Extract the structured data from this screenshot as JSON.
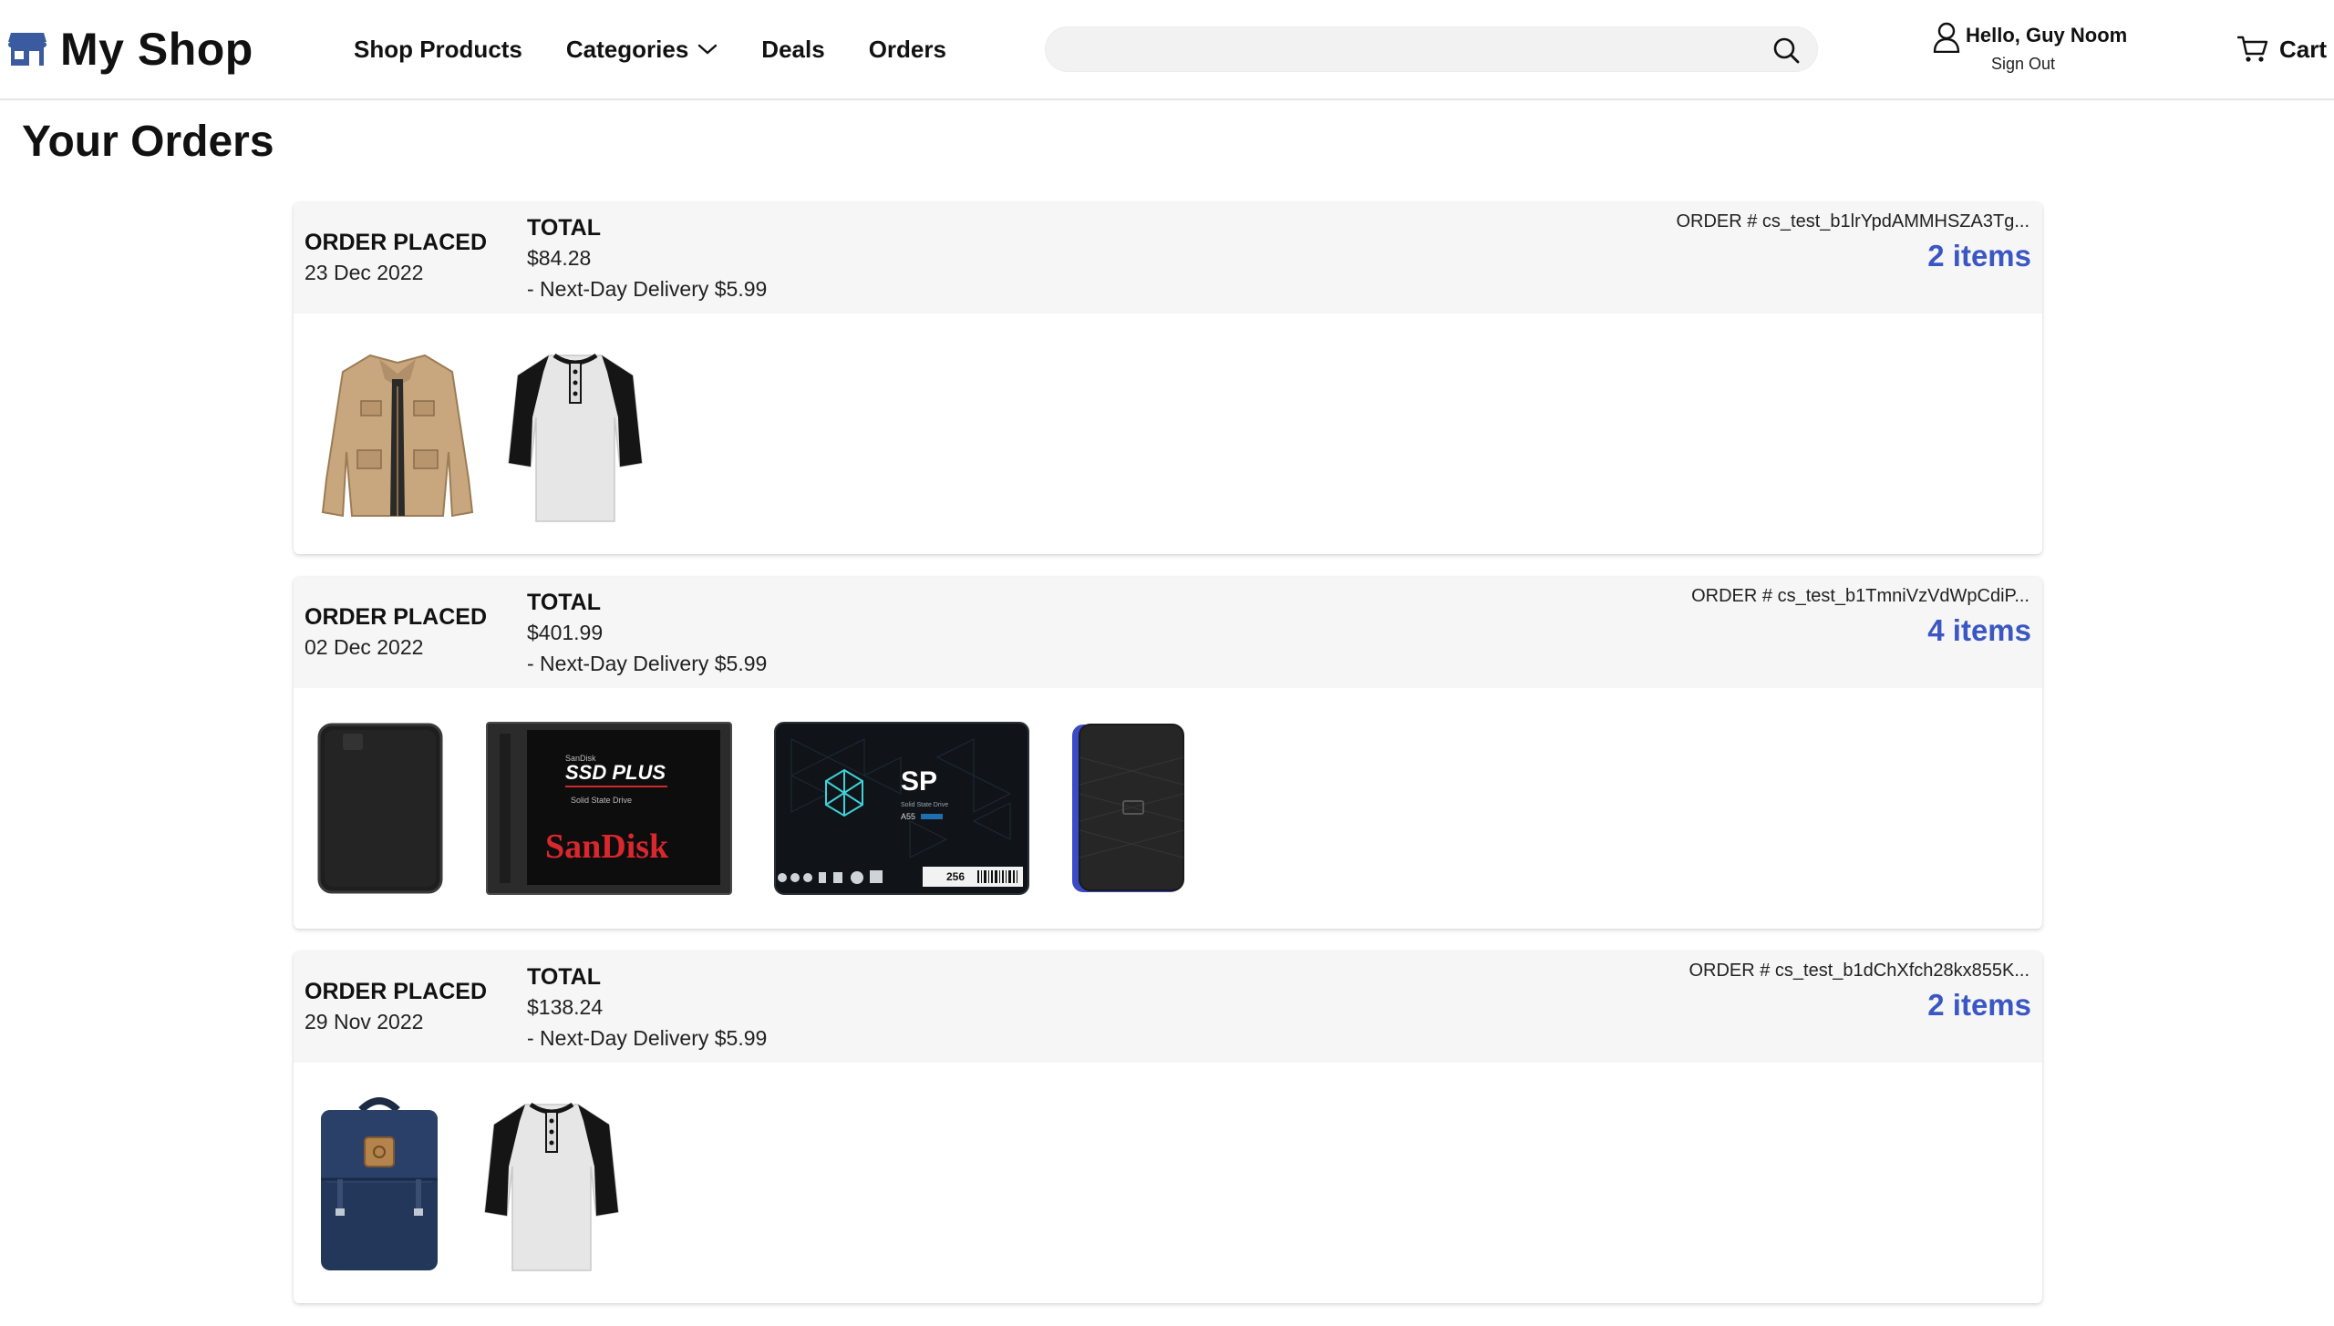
{
  "header": {
    "logo_text": "My Shop",
    "nav": {
      "shop_products": "Shop Products",
      "categories": "Categories",
      "deals": "Deals",
      "orders": "Orders"
    },
    "search": {
      "value": "",
      "placeholder": ""
    },
    "account": {
      "greeting": "Hello, Guy Noom",
      "sign_out": "Sign Out"
    },
    "cart_label": "Cart"
  },
  "page": {
    "title": "Your Orders"
  },
  "labels": {
    "order_placed": "ORDER PLACED",
    "total": "TOTAL"
  },
  "orders": [
    {
      "date": "23 Dec 2022",
      "total": "$84.28",
      "delivery": "- Next-Day Delivery $5.99",
      "order_number": "ORDER # cs_test_b1lrYpdAMMHSZA3Tg...",
      "items_count": "2 items",
      "products": [
        "jacket-tan",
        "henley-tshirt"
      ]
    },
    {
      "date": "02 Dec 2022",
      "total": "$401.99",
      "delivery": "- Next-Day Delivery $5.99",
      "order_number": "ORDER # cs_test_b1TmniVzVdWpCdiP...",
      "items_count": "4 items",
      "products": [
        "external-hdd-black",
        "sandisk-ssd",
        "sp-ssd",
        "external-hdd-blue"
      ],
      "product_text": {
        "sandisk_small": "SanDisk",
        "sandisk_title": "SSD PLUS",
        "sandisk_sub": "Solid State Drive",
        "sandisk_brand": "SanDisk",
        "sp_brand": "SP",
        "sp_sub": "Solid State Drive",
        "sp_model": "A55",
        "sp_capacity": "256"
      }
    },
    {
      "date": "29 Nov 2022",
      "total": "$138.24",
      "delivery": "- Next-Day Delivery $5.99",
      "order_number": "ORDER # cs_test_b1dChXfch28kx855K...",
      "items_count": "2 items",
      "products": [
        "backpack-navy",
        "henley-tshirt"
      ]
    }
  ],
  "colors": {
    "accent": "#3b57c4",
    "logo": "#3a5ba0",
    "card_header_bg": "#f6f6f6"
  }
}
